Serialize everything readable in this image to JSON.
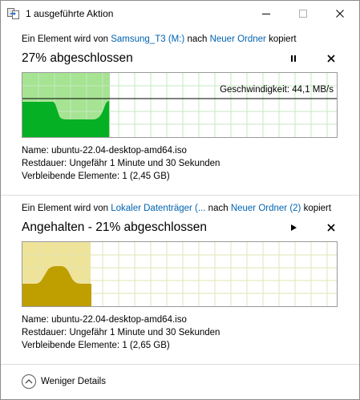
{
  "window": {
    "title": "1 ausgeführte Aktion",
    "icon": "file-copy-icon"
  },
  "operations": [
    {
      "desc_prefix": "Ein Element wird von ",
      "source": "Samsung_T3 (M:)",
      "desc_middle": " nach ",
      "destination": "Neuer Ordner",
      "desc_suffix": " kopiert",
      "status": "27% abgeschlossen",
      "progress": 0.27,
      "state": "running",
      "speed_label": "Geschwindigkeit: 44,1 MB/s",
      "fill_color": "#a6e393",
      "area_color": "#06b025",
      "name_label": "Name: ",
      "name_value": "ubuntu-22.04-desktop-amd64.iso",
      "remaining_label": "Restdauer: ",
      "remaining_value": "Ungefähr 1 Minute und 30 Sekunden",
      "items_label": "Verbleibende Elemente: ",
      "items_value": "1 (2,45 GB)"
    },
    {
      "desc_prefix": "Ein Element wird von ",
      "source": "Lokaler Datenträger (...",
      "desc_middle": " nach ",
      "destination": "Neuer Ordner (2)",
      "desc_suffix": " kopiert",
      "status": "Angehalten - 21% abgeschlossen",
      "progress": 0.21,
      "state": "paused",
      "speed_label": "",
      "fill_color": "#efe39a",
      "area_color": "#bf9e00",
      "name_label": "Name: ",
      "name_value": "ubuntu-22.04-desktop-amd64.iso",
      "remaining_label": "Restdauer: ",
      "remaining_value": "Ungefähr 1 Minute und 30 Sekunden",
      "items_label": "Verbleibende Elemente: ",
      "items_value": "1 (2,65 GB)"
    }
  ],
  "footer": {
    "details_label": "Weniger Details"
  }
}
